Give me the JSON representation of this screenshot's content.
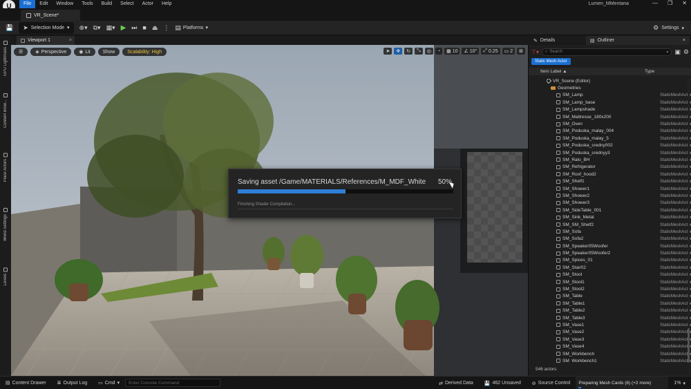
{
  "menubar": {
    "logo": "U",
    "items": [
      "File",
      "Edit",
      "Window",
      "Tools",
      "Build",
      "Select",
      "Actor",
      "Help"
    ],
    "project_name": "Lumen_MMentana",
    "win_min": "—",
    "win_restore": "❐",
    "win_close": "✕"
  },
  "tabs": {
    "scene_tab": "VR_Scene*"
  },
  "toolbar": {
    "save_icon": "💾",
    "selection_mode": "Selection Mode",
    "platforms": "Platforms",
    "settings": "Settings"
  },
  "leftrail": [
    "GPU Lightmass",
    "Content Brow...",
    "Place Actors",
    "World Settings",
    "Levels"
  ],
  "viewport": {
    "tab_label": "Viewport 1",
    "menu_icon": "☰",
    "perspective": "Perspective",
    "lit": "Lit",
    "show": "Show",
    "scalability": "Scalability: High",
    "grid_size": "10",
    "rotation_snap": "10°",
    "scale_snap": "0.25",
    "camera_speed": "2"
  },
  "save_dialog": {
    "title": "Saving asset /Game/MATERIALS/References/M_MDF_White",
    "percent": "50%",
    "progress": 0.5,
    "status": "Finishing Shader Compilation..."
  },
  "panel": {
    "details_tab": "Details",
    "outliner_tab": "Outliner",
    "close": "×",
    "search_placeholder": "Search",
    "filter_chip": "Static Mesh Actor",
    "col_label": "Item Label ▲",
    "col_type": "Type",
    "scene_root": "VR_Scene (Editor)",
    "folder": "Geometries",
    "rows": [
      {
        "name": "SM_Lamp",
        "type": "StaticMeshActor"
      },
      {
        "name": "SM_Lamp_base",
        "type": "StaticMeshActor"
      },
      {
        "name": "SM_Lampshade",
        "type": "StaticMeshActor"
      },
      {
        "name": "SM_Mattresse_180x200",
        "type": "StaticMeshActor"
      },
      {
        "name": "SM_Oven",
        "type": "StaticMeshActor"
      },
      {
        "name": "SM_Poduska_malay_004",
        "type": "StaticMeshActor"
      },
      {
        "name": "SM_Poduska_malay_5",
        "type": "StaticMeshActor"
      },
      {
        "name": "SM_Poduska_sredny002",
        "type": "StaticMeshActor"
      },
      {
        "name": "SM_Poduska_srednyy3",
        "type": "StaticMeshActor"
      },
      {
        "name": "SM_Ralo_BH",
        "type": "StaticMeshActor"
      },
      {
        "name": "SM_Refrigerator",
        "type": "StaticMeshActor"
      },
      {
        "name": "SM_Roof_hood2",
        "type": "StaticMeshActor"
      },
      {
        "name": "SM_Shelf1",
        "type": "StaticMeshActor"
      },
      {
        "name": "SM_Shower1",
        "type": "StaticMeshActor"
      },
      {
        "name": "SM_Shower2",
        "type": "StaticMeshActor"
      },
      {
        "name": "SM_Shower3",
        "type": "StaticMeshActor"
      },
      {
        "name": "SM_SideTable_001",
        "type": "StaticMeshActor"
      },
      {
        "name": "SM_Sink_Metal",
        "type": "StaticMeshActor"
      },
      {
        "name": "SM_SM_Shelf2",
        "type": "StaticMeshActor"
      },
      {
        "name": "SM_Sofa",
        "type": "StaticMeshActor"
      },
      {
        "name": "SM_Sofa2",
        "type": "StaticMeshActor"
      },
      {
        "name": "SM_Speaker05Woofer",
        "type": "StaticMeshActor"
      },
      {
        "name": "SM_Speaker05Woofer2",
        "type": "StaticMeshActor"
      },
      {
        "name": "SM_Spices_01",
        "type": "StaticMeshActor"
      },
      {
        "name": "SM_Stair02",
        "type": "StaticMeshActor"
      },
      {
        "name": "SM_Stool",
        "type": "StaticMeshActor"
      },
      {
        "name": "SM_Stool1",
        "type": "StaticMeshActor"
      },
      {
        "name": "SM_Stool2",
        "type": "StaticMeshActor"
      },
      {
        "name": "SM_Table",
        "type": "StaticMeshActor"
      },
      {
        "name": "SM_Table1",
        "type": "StaticMeshActor"
      },
      {
        "name": "SM_Table2",
        "type": "StaticMeshActor"
      },
      {
        "name": "SM_Table3",
        "type": "StaticMeshActor"
      },
      {
        "name": "SM_Vase1",
        "type": "StaticMeshActor"
      },
      {
        "name": "SM_Vase2",
        "type": "StaticMeshActor"
      },
      {
        "name": "SM_Vase3",
        "type": "StaticMeshActor"
      },
      {
        "name": "SM_Vase4",
        "type": "StaticMeshActor"
      },
      {
        "name": "SM_Workbench",
        "type": "StaticMeshActor"
      },
      {
        "name": "SM_Workbench1",
        "type": "StaticMeshActor"
      }
    ],
    "actors_count": "546 actors"
  },
  "statusbar": {
    "content_drawer": "Content Drawer",
    "output_log": "Output Log",
    "cmd": "Cmd",
    "console_placeholder": "Enter Console Command",
    "derived_data": "Derived Data",
    "unsaved": "462 Unsaved",
    "source_control": "Source Control",
    "mesh_cards": "Preparing Mesh Cards (6) (+2 more)",
    "mesh_pct": "1%"
  },
  "colors": {
    "accent": "#1b6fd0",
    "progress": "#2f7fd8",
    "scalability": "#f0c43a"
  }
}
